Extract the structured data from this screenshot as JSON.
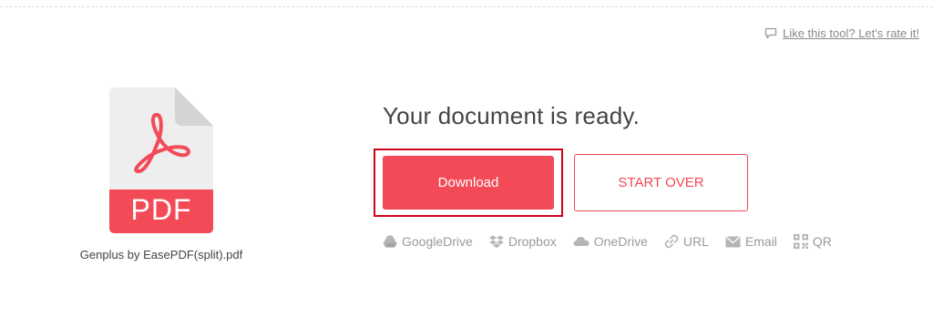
{
  "rate_link": {
    "label": "Like this tool? Let's rate it!",
    "icon": "comment-icon"
  },
  "file": {
    "badge": "PDF",
    "name": "Genplus by EasePDF(split).pdf",
    "icon": "pdf-file-icon",
    "accent_color": "#f34a57"
  },
  "result": {
    "title": "Your document is ready.",
    "download_label": "Download",
    "start_over_label": "START OVER"
  },
  "save_options": [
    {
      "label": "GoogleDrive",
      "icon": "google-drive-icon"
    },
    {
      "label": "Dropbox",
      "icon": "dropbox-icon"
    },
    {
      "label": "OneDrive",
      "icon": "onedrive-icon"
    },
    {
      "label": "URL",
      "icon": "link-icon"
    },
    {
      "label": "Email",
      "icon": "email-icon"
    },
    {
      "label": "QR",
      "icon": "qr-code-icon"
    }
  ],
  "colors": {
    "accent": "#f34a57",
    "highlight_border": "#d0021b",
    "muted_text": "#9a9a9a"
  }
}
